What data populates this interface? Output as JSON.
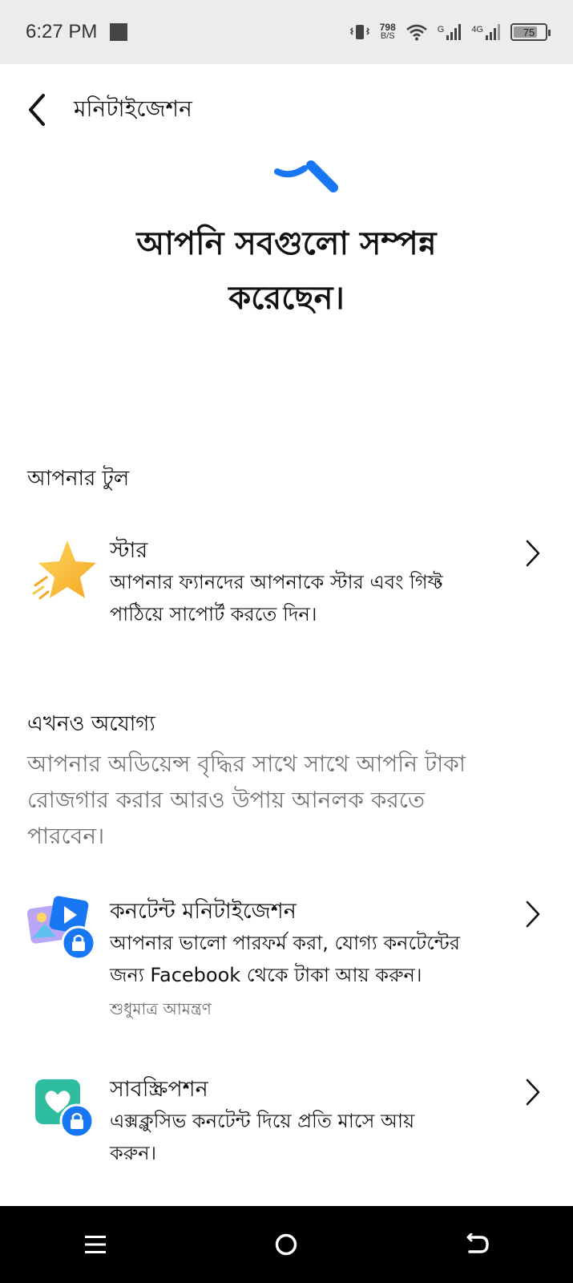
{
  "status_bar": {
    "time": "6:27 PM",
    "net_speed_value": "798",
    "net_speed_unit": "B/S",
    "sim1_label": "G",
    "sim2_label": "4G",
    "battery": "75",
    "battery_level": 0.75
  },
  "header": {
    "title": "মনিটাইজেশন"
  },
  "hero": {
    "title_line1": "আপনি সবগুলো সম্পন্ন",
    "title_line2": "করেছেন।"
  },
  "tools_section": {
    "label": "আপনার টুল",
    "items": [
      {
        "title": "স্টার",
        "desc_line1": "আপনার ফ্যানদের আপনাকে স্টার এবং গিফ্ট",
        "desc_line2": "পাঠিয়ে সাপোর্ট করতে দিন।"
      }
    ]
  },
  "ineligible_section": {
    "label": "এখনও অযোগ্য",
    "desc_line1": "আপনার অডিয়েন্স বৃদ্ধির সাথে সাথে আপনি টাকা",
    "desc_line2": "রোজগার করার আরও উপায় আনলক করতে",
    "desc_line3": "পারবেন।",
    "items": [
      {
        "title": "কনটেন্ট মনিটাইজেশন",
        "desc_line1": "আপনার ভালো পারফর্ম করা, যোগ্য কনটেন্টের",
        "desc_line2": "জন্য Facebook থেকে টাকা আয় করুন।",
        "note": "শুধুমাত্র আমন্ত্রণ"
      },
      {
        "title": "সাবস্ক্রিপশন",
        "desc_line1": "এক্সক্লুসিভ কনটেন্ট দিয়ে প্রতি মাসে আয়",
        "desc_line2": "করুন।"
      }
    ]
  },
  "colors": {
    "accent_blue": "#1877f2",
    "star_yellow": "#f7c948",
    "subscription_green": "#2ebd9e",
    "nav_bar": "#000000",
    "status_bar_bg": "#ececec"
  },
  "icons": {
    "back": "back-arrow-icon",
    "chevron": "chevron-right-icon",
    "star": "star-icon",
    "content": "content-monetization-icon",
    "subscription": "subscription-heart-icon",
    "lock": "lock-icon",
    "menu": "recent-apps-icon",
    "home": "home-icon",
    "back_nav": "back-nav-icon"
  }
}
